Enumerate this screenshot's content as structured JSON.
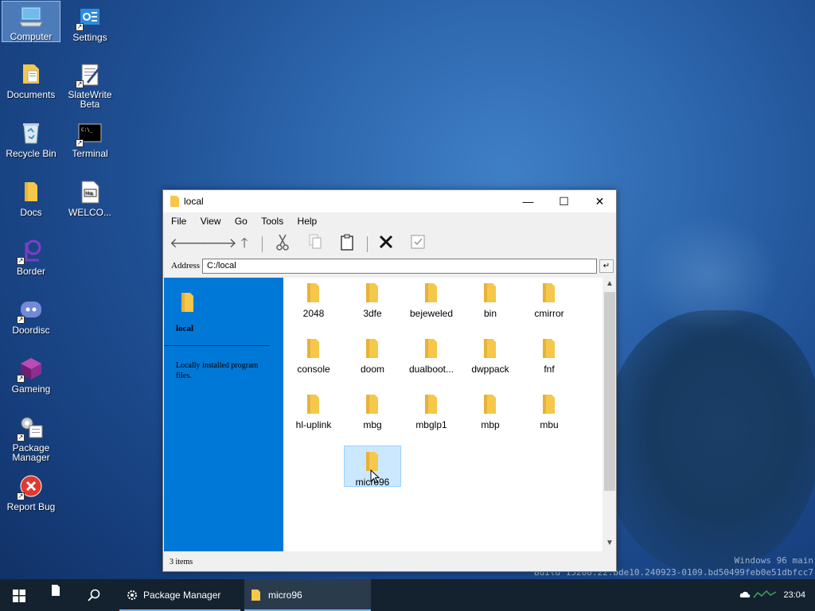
{
  "desktop": {
    "icons": [
      {
        "label": "Computer"
      },
      {
        "label": "Settings"
      },
      {
        "label": "Documents"
      },
      {
        "label": "SlateWrite Beta"
      },
      {
        "label": "Recycle Bin"
      },
      {
        "label": "Terminal"
      },
      {
        "label": "Docs"
      },
      {
        "label": "WELCO..."
      },
      {
        "label": "Border"
      },
      {
        "label": "Doordisc"
      },
      {
        "label": "Gameing"
      },
      {
        "label": "Package Manager"
      },
      {
        "label": "Report Bug"
      }
    ],
    "terminal_glyph": "C:\\_",
    "welcome_glyph": "M⊕"
  },
  "window": {
    "title": "local",
    "controls": {
      "minimize": "—",
      "maximize": "☐",
      "close": "✕"
    },
    "menu": [
      "File",
      "View",
      "Go",
      "Tools",
      "Help"
    ],
    "address_label": "Address",
    "address_value": "C:/local",
    "address_go": "↵",
    "side_panel": {
      "title": "local",
      "description": "Locally installed program files."
    },
    "files": [
      "2048",
      "3dfe",
      "bejeweled",
      "bin",
      "cmirror",
      "console",
      "doom",
      "dualboot...",
      "dwppack",
      "fnf",
      "hl-uplink",
      "mbg",
      "mbglp1",
      "mbp",
      "mbu",
      "micro96"
    ],
    "selected_file": "micro96",
    "status": "3 items"
  },
  "watermark": {
    "line1": "Windows 96 main",
    "line2": "Build 15288.22.bde10.240923-0109.bd50499feb0e51dbfcc7"
  },
  "taskbar": {
    "tasks": [
      {
        "label": "Package Manager",
        "active": false
      },
      {
        "label": "micro96",
        "active": true
      }
    ],
    "clock": "23:04"
  },
  "colors": {
    "accent": "#0078d7",
    "folder": "#f5c74a",
    "taskbar": "#14222f"
  }
}
